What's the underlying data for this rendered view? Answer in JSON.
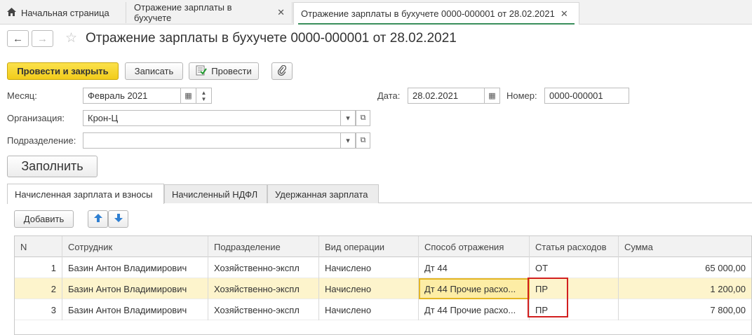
{
  "tabs": [
    {
      "label": "Начальная страница",
      "icon": "home-icon"
    },
    {
      "label": "Отражение зарплаты в бухучете",
      "closable": true
    },
    {
      "label": "Отражение зарплаты в бухучете 0000-000001 от 28.02.2021",
      "closable": true,
      "active": true
    }
  ],
  "header": {
    "title": "Отражение зарплаты в бухучете 0000-000001 от 28.02.2021",
    "back": "←",
    "forward": "→",
    "favorite": "☆"
  },
  "toolbar": {
    "post_close": "Провести и закрыть",
    "save": "Записать",
    "post": "Провести",
    "attach_icon": "paperclip-icon"
  },
  "form": {
    "month_label": "Месяц:",
    "month_value": "Февраль 2021",
    "date_label": "Дата:",
    "date_value": "28.02.2021",
    "number_label": "Номер:",
    "number_value": "0000-000001",
    "org_label": "Организация:",
    "org_value": "Крон-Ц",
    "dept_label": "Подразделение:",
    "dept_value": ""
  },
  "fill_button": "Заполнить",
  "inner_tabs": [
    {
      "label": "Начисленная зарплата и взносы",
      "active": true
    },
    {
      "label": "Начисленный НДФЛ"
    },
    {
      "label": "Удержанная зарплата"
    }
  ],
  "table_toolbar": {
    "add": "Добавить"
  },
  "table": {
    "columns": [
      "N",
      "Сотрудник",
      "Подразделение",
      "Вид операции",
      "Способ отражения",
      "Статья расходов",
      "Сумма"
    ],
    "rows": [
      {
        "n": "1",
        "employee": "Базин Антон Владимирович",
        "dept": "Хозяйственно-экспл",
        "op": "Начислено",
        "method": "Дт 44",
        "expense": "ОТ",
        "sum": "65 000,00"
      },
      {
        "n": "2",
        "employee": "Базин Антон Владимирович",
        "dept": "Хозяйственно-экспл",
        "op": "Начислено",
        "method": "Дт 44 Прочие расхо...",
        "expense": "ПР",
        "sum": "1 200,00",
        "selected": true
      },
      {
        "n": "3",
        "employee": "Базин Антон Владимирович",
        "dept": "Хозяйственно-экспл",
        "op": "Начислено",
        "method": "Дт 44 Прочие расхо...",
        "expense": "ПР",
        "sum": "7 800,00"
      }
    ]
  },
  "highlight_color": "#d21f1f",
  "accent_yellow": "#f5d327"
}
